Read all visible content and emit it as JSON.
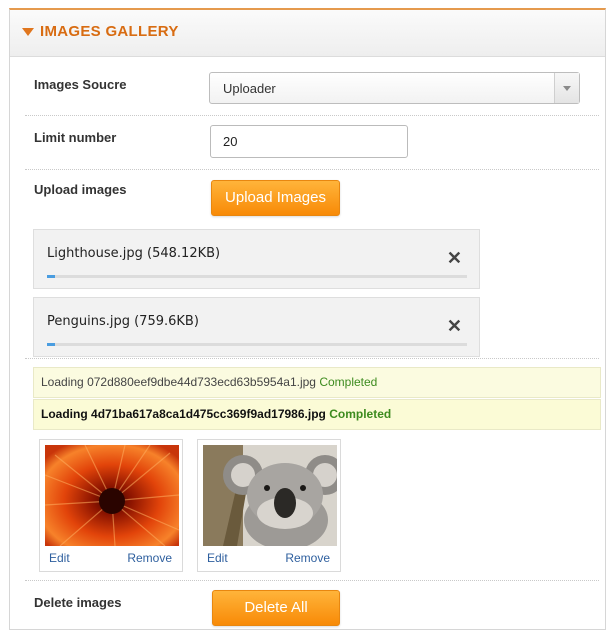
{
  "header": {
    "title": "IMAGES GALLERY"
  },
  "images_source": {
    "label": "Images Soucre",
    "value": "Uploader"
  },
  "limit_number": {
    "label": "Limit number",
    "value": "20"
  },
  "upload": {
    "label": "Upload images",
    "button": "Upload Images"
  },
  "files": [
    {
      "name": "Lighthouse.jpg (548.12KB)",
      "progress": 0.01
    },
    {
      "name": "Penguins.jpg (759.6KB)",
      "progress": 0.01
    }
  ],
  "log": [
    {
      "prefix": "Loading",
      "file": "072d880eef9dbe44d733ecd63b5954a1.jpg",
      "status": "Completed"
    },
    {
      "prefix": "Loading",
      "file": "4d71ba617a8ca1d475cc369f9ad17986.jpg",
      "status": "Completed"
    }
  ],
  "gallery": [
    {
      "subject": "flower",
      "edit": "Edit",
      "remove": "Remove"
    },
    {
      "subject": "koala",
      "edit": "Edit",
      "remove": "Remove"
    }
  ],
  "delete": {
    "label": "Delete images",
    "button": "Delete All"
  },
  "colors": {
    "accent": "#e0761e",
    "button": "#f88a07",
    "link": "#2e5f9e",
    "completed": "#3d8b1f"
  }
}
